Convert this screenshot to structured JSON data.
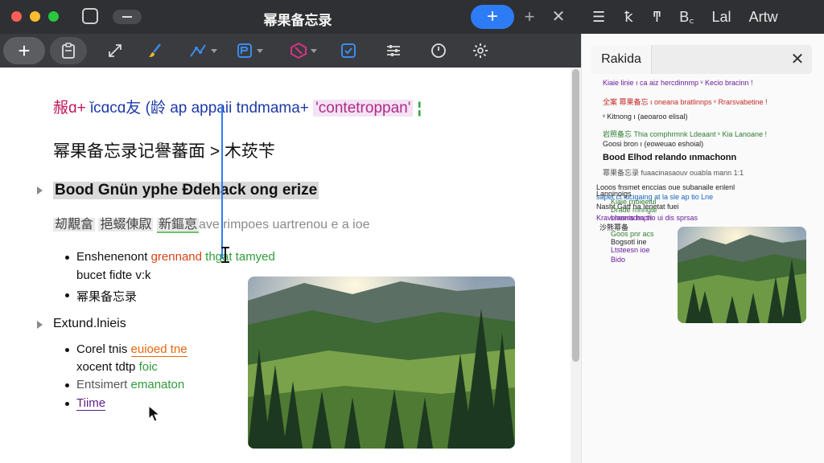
{
  "window": {
    "title": "幂果备忘录"
  },
  "right_toolbar": {
    "items": [
      "☰",
      "ꝁ",
      "ͳ",
      "B꜀",
      "Lal",
      "Artw"
    ]
  },
  "right_panel": {
    "tab_label": "Rakida",
    "lines": [
      {
        "text": "Kiaie  linie  ı  ca  aiz  hercdinnmp  ᵛ  Kecio  bracinn  !",
        "color": "#6a1b9a"
      },
      {
        "text": "全案 幂果备忘  ı  oneana  bratlinnps  ᵛ  Rrarsvabetine !",
        "color": "#c62828"
      },
      {
        "text": "ᵛ  Kitnong  ı  (aeoaroo  elisal)",
        "color": "#222222"
      },
      {
        "text": "岩照备忘  Thia  comphrmnk  Ldeaant  ᵛ  Kia  Lanoane !",
        "color": "#2e7d32"
      },
      {
        "text": "     Goosi  bron  ı  (eoweuao  eshoial)",
        "color": "#222222"
      },
      {
        "text": "Bood  Elhod  relando  ınmachonn",
        "color": "#111111"
      },
      {
        "text": "幂果备忘录  fuaacinasaouv  ouabla  mann  1:1",
        "color": "#555555"
      },
      {
        "text": "Looos  fnsmet  enccias  oue  subanaile  enlenl",
        "color": "#222222"
      },
      {
        "text": "sapet  ct  lucigaing  at  la  sle  ap  tio  Lne",
        "color": "#1565c0"
      },
      {
        "text": "Nasht  Gatf  ha  Ienetat  fuei",
        "color": "#222222"
      },
      {
        "text": "Kraveiaonis  ha  tlio  ui  dis  sprsas",
        "color": "#6a1b9a"
      },
      {
        "text": "Lanninoigs",
        "color": "#222222"
      },
      {
        "text": "Kiaie  rnoieeiul",
        "color": "#2e7d32"
      },
      {
        "text": "Drade  rrinngte",
        "color": "#2e7d32"
      },
      {
        "text": "Lheeradrnpri",
        "color": "#6a1b9a"
      },
      {
        "text": "沙熊幂备",
        "color": "#222222"
      },
      {
        "text": "Goos  pnr  acs",
        "color": "#2e7d32"
      },
      {
        "text": "Bogsotl  ine",
        "color": "#222222"
      },
      {
        "text": "Ltsteesn  ioe",
        "color": "#6a1b9a"
      },
      {
        "text": "Bido",
        "color": "#6a1b9a"
      }
    ]
  },
  "editor": {
    "line1": {
      "a": "赧ɑ+",
      "b": " ǐcɑcɑ友 (龄 ap appaii tndmama+ ",
      "tag": "'contetroppan'",
      "end": " ¦"
    },
    "line2": "幂果备忘录记譽蕃面 > 木莰苄",
    "line3": "Bood Gnün yphe Ɖdehack ong erize",
    "line4": {
      "a": "刼覯畣",
      "b": "挹蝃倲叞",
      "c": "新鏂恴",
      "ghost": "ave rimpoes uartrenou e a ioe"
    },
    "bullets1": [
      {
        "a": "Enshenenont ",
        "b": "grennand",
        "c": " thgat tamyed"
      },
      {
        "a": "bucet fidte  v:k"
      },
      {
        "a": "幂果备忘录"
      }
    ],
    "heading2": "Extund.lnieis",
    "bullets2": [
      {
        "a": "Corel tnis ",
        "b": "euioed tne"
      },
      {
        "a": "xocent  tdtp ",
        "b": "foic"
      },
      {
        "a": "Entsimert ",
        "b": "emanaton"
      },
      {
        "a": "Tiime"
      }
    ]
  },
  "colors": {
    "accent": "#2d7cf6",
    "titlebar": "#2f3033",
    "toolbar": "#3a3b3e"
  }
}
